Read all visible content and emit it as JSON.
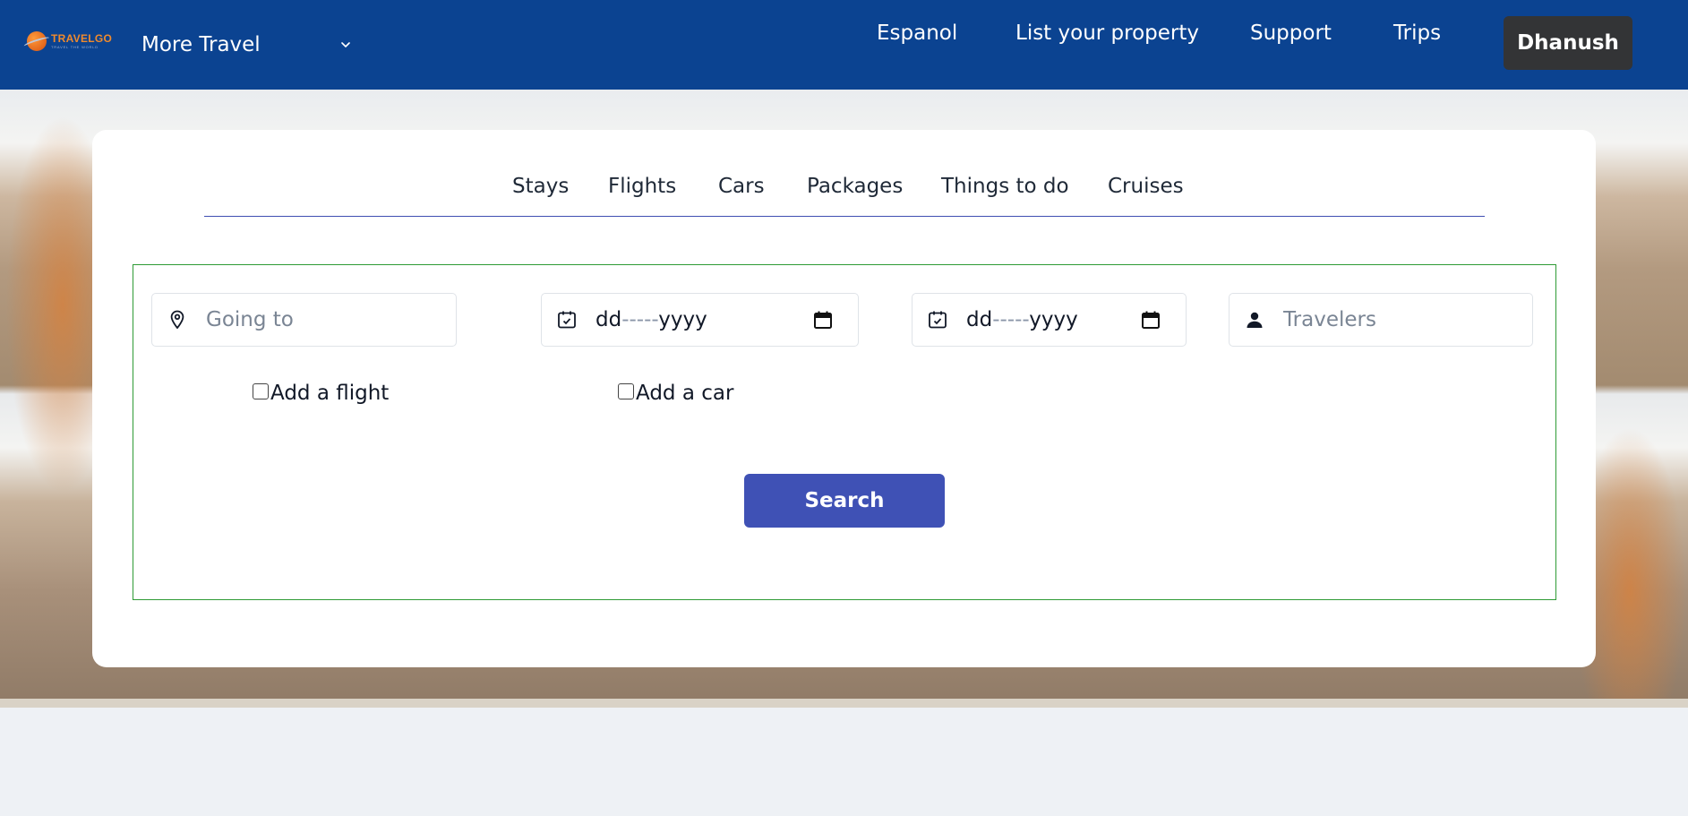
{
  "header": {
    "logo": {
      "name": "TRAVELGO",
      "tagline": "TRAVEL THE WORLD"
    },
    "more_travel": {
      "label": "More Travel"
    },
    "nav": [
      "Espanol",
      "List your property",
      "Support",
      "Trips"
    ],
    "user": {
      "name": "Dhanush"
    }
  },
  "search": {
    "tabs": [
      "Stays",
      "Flights",
      "Cars",
      "Packages",
      "Things to do",
      "Cruises"
    ],
    "destination": {
      "placeholder": "Going to"
    },
    "check_in": {
      "day": "dd",
      "sep": "-----",
      "year": "yyyy"
    },
    "check_out": {
      "day": "dd",
      "sep": "-----",
      "year": "yyyy"
    },
    "travelers": {
      "placeholder": "Travelers"
    },
    "options": [
      "Add a flight",
      "Add a car"
    ],
    "search_label": "Search"
  },
  "colors": {
    "header_bg": "#0b4391",
    "user_btn_bg": "#333436",
    "search_btn_bg": "#3f51b5",
    "form_border": "#2e9b35",
    "tabs_underline": "#3f4fb2",
    "page_bg": "#eef1f5",
    "logo_accent": "#f08a2c"
  },
  "icons": {
    "location": "map-pin-icon",
    "calendar": "calendar-check-icon",
    "calendar_picker": "calendar-icon",
    "person": "person-icon",
    "chevron": "chevron-down-icon"
  }
}
